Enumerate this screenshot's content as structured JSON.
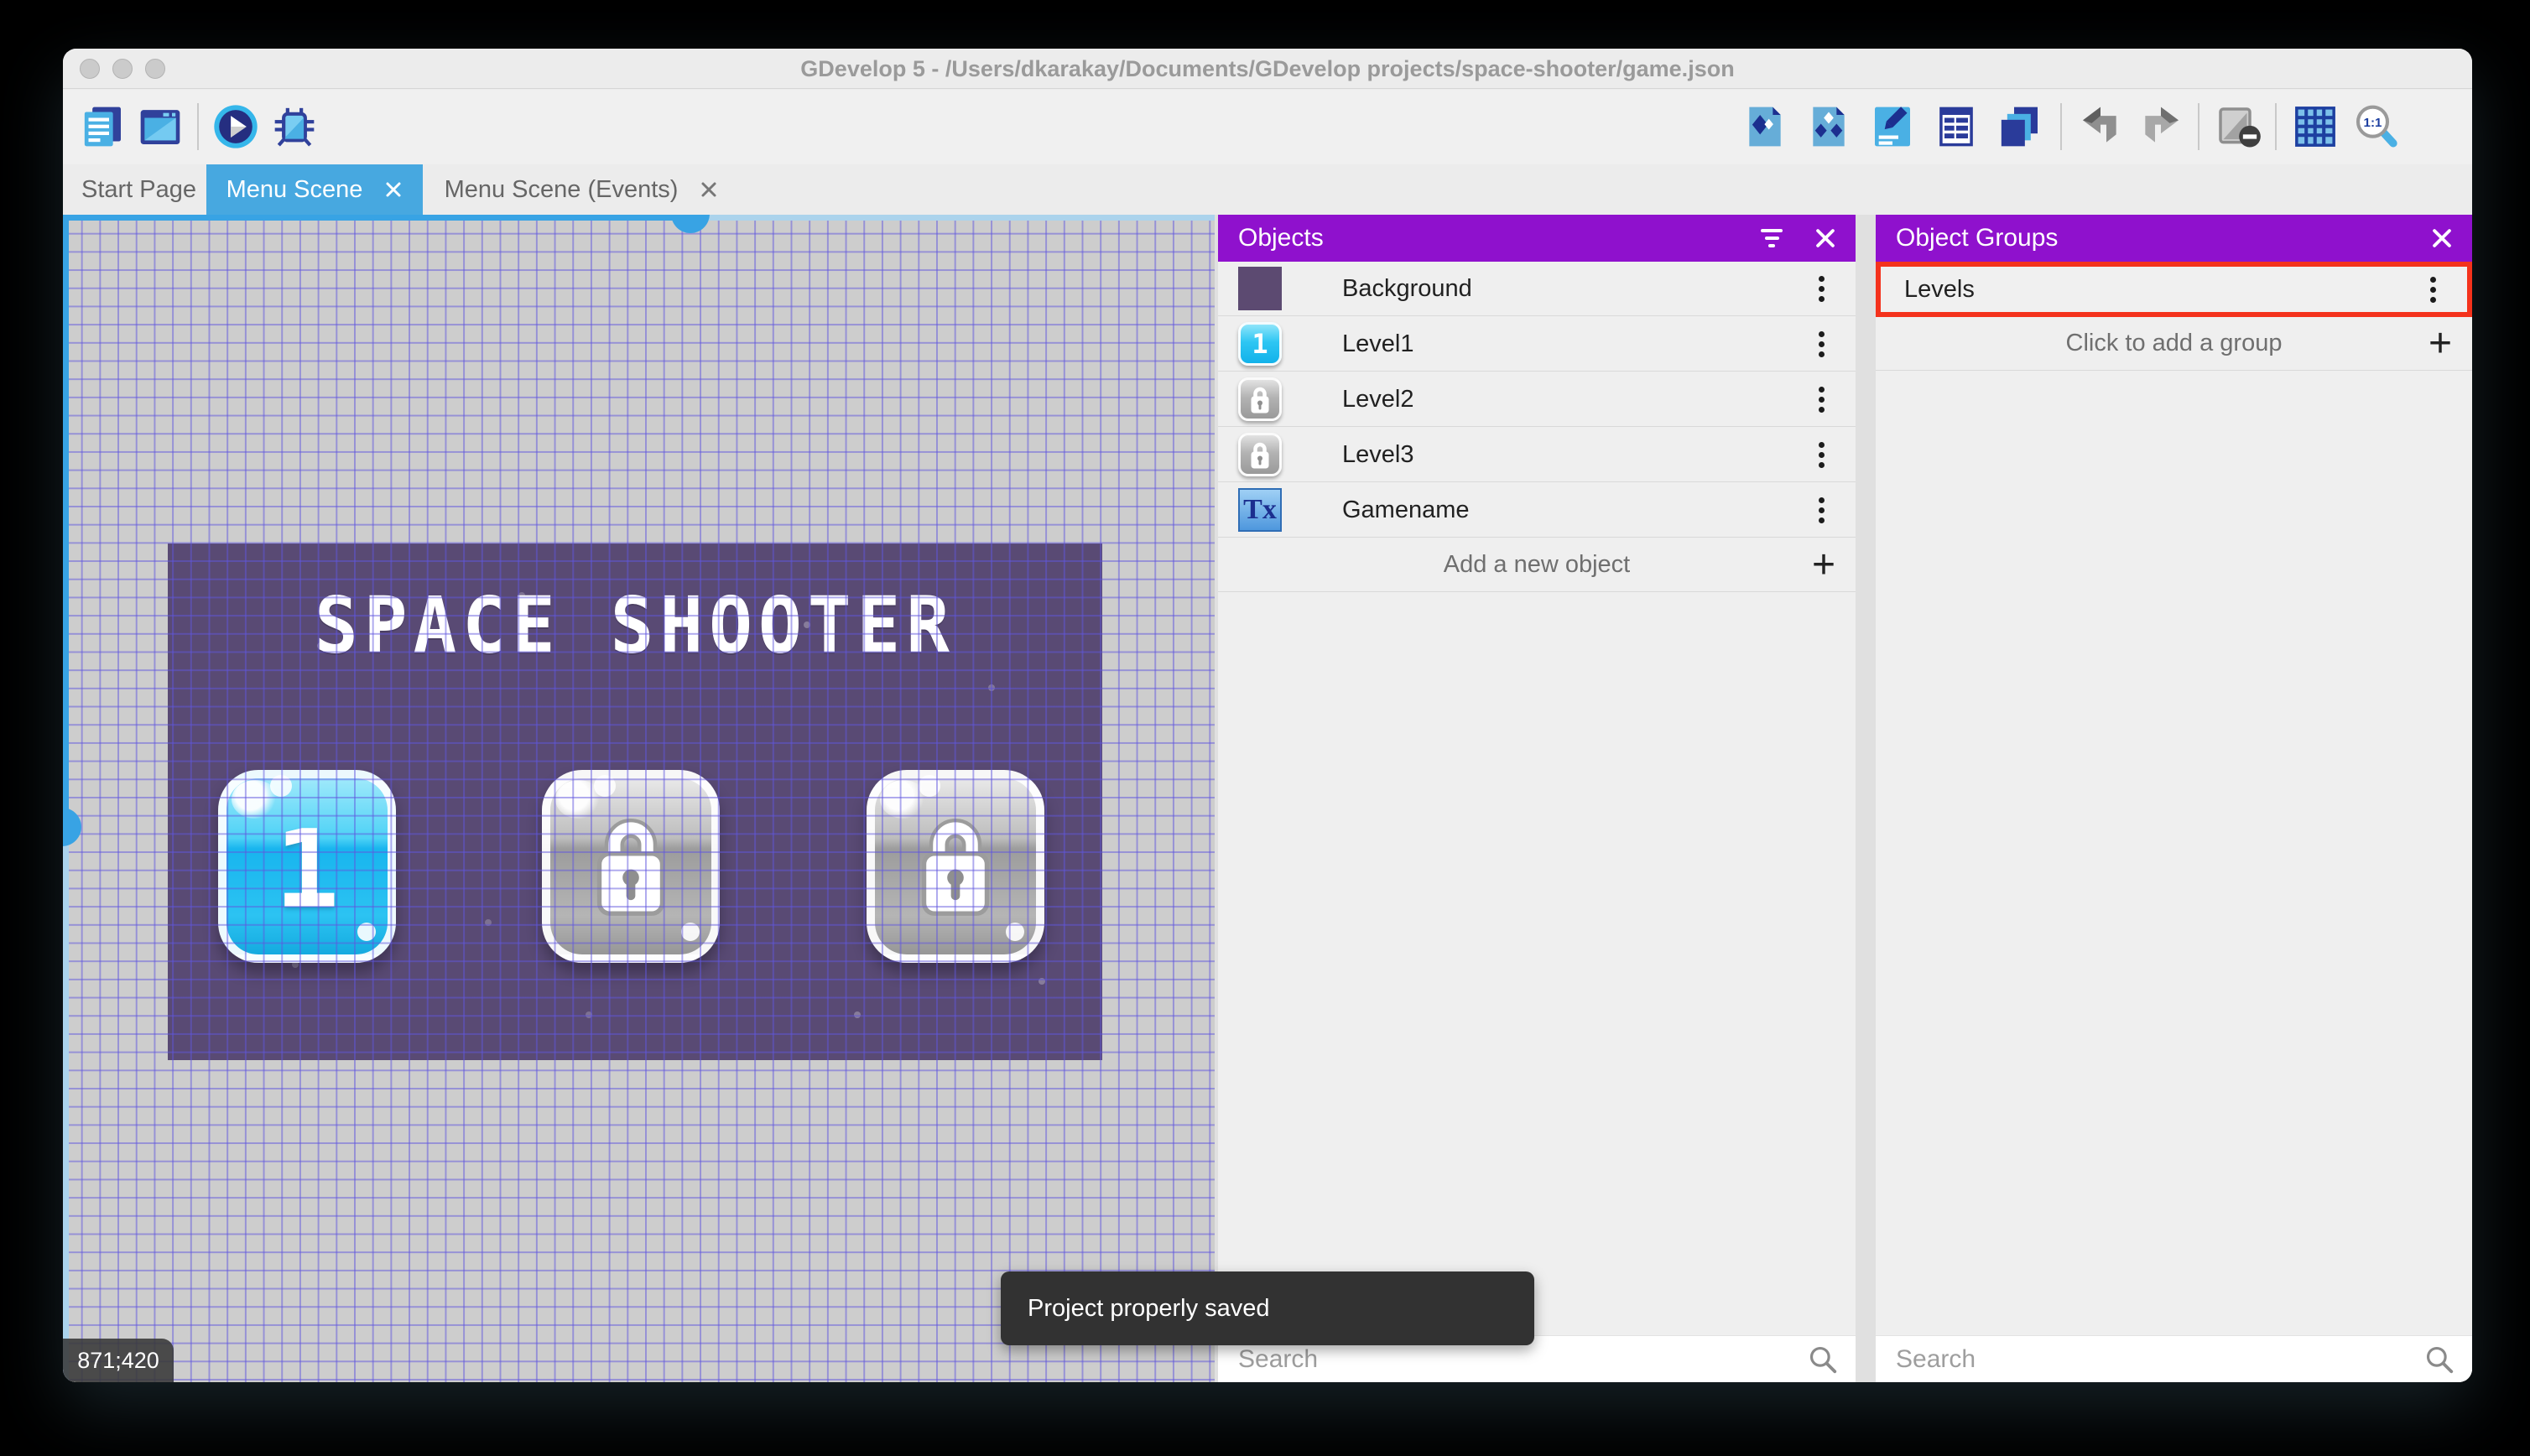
{
  "window_title": "GDevelop 5 - /Users/dkarakay/Documents/GDevelop projects/space-shooter/game.json",
  "tabs": [
    {
      "label": "Start Page"
    },
    {
      "label": "Menu Scene"
    },
    {
      "label": "Menu Scene (Events)"
    }
  ],
  "toolbar": {
    "zoom_icon_label": "1:1"
  },
  "scene": {
    "game_title": "SPACE SHOOTER",
    "coordinates": "871;420",
    "level1_button_label": "1"
  },
  "objects_panel": {
    "title": "Objects",
    "items": [
      {
        "name": "Background"
      },
      {
        "name": "Level1",
        "icon_label": "1"
      },
      {
        "name": "Level2"
      },
      {
        "name": "Level3"
      },
      {
        "name": "Gamename",
        "icon_label": "Tx"
      }
    ],
    "add_label": "Add a new object",
    "search_placeholder": "Search"
  },
  "object_groups_panel": {
    "title": "Object Groups",
    "groups": [
      {
        "name": "Levels"
      }
    ],
    "add_label": "Click to add a group",
    "search_placeholder": "Search"
  },
  "toast_message": "Project properly saved",
  "glyphs": {
    "plus": "+"
  },
  "colors": {
    "panel_header": "#8f11cd",
    "active_tab": "#47a8e0",
    "selection_highlight": "#f4321c",
    "game_background": "#594a74",
    "toast_background": "#323232",
    "scrollbar_blue": "#38a3e4"
  }
}
